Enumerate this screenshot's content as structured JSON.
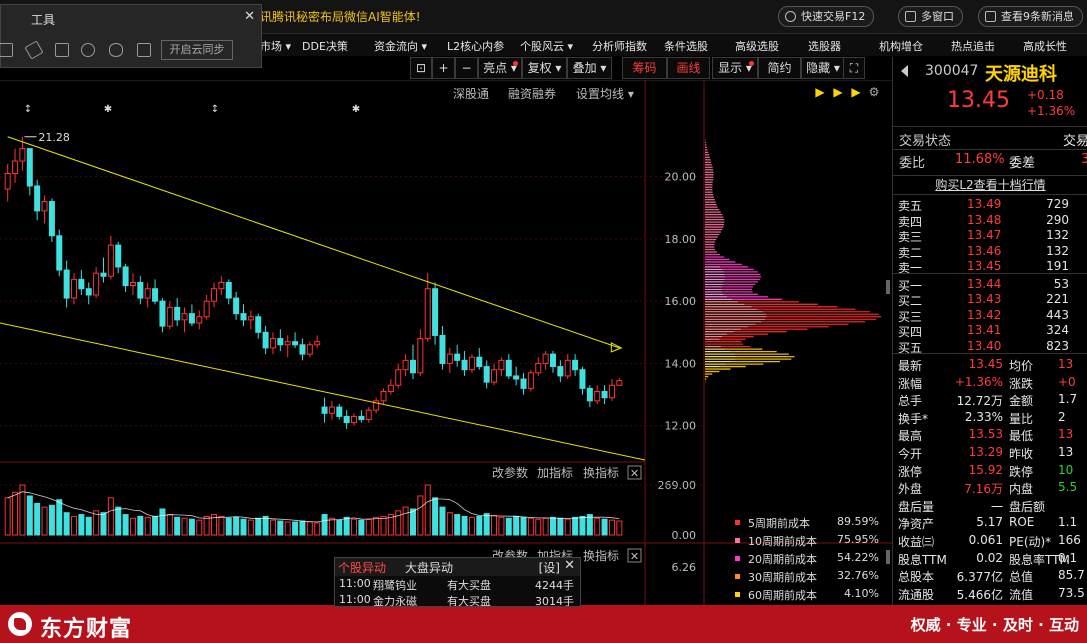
{
  "topbar": {
    "news": "讯腾讯秘密布局微信AI智能体!",
    "quick_trade": "快速交易F12",
    "multi_window": "多窗口",
    "messages": "查看9条新消息"
  },
  "tool_panel": {
    "title": "工具",
    "sync": "开启云同步",
    "icons": [
      "brush-icon",
      "eraser-icon",
      "trash-icon",
      "gear-icon",
      "eye-icon",
      "export-icon"
    ]
  },
  "menu": [
    "市场 ▾",
    "DDE决策",
    "资金流向 ▾",
    "L2核心内参",
    "个股风云 ▾",
    "分析师指数",
    "条件选股",
    "高级选股",
    "选股器",
    "机构增仓",
    "热点追击",
    "高成长性"
  ],
  "chart_toolbar": {
    "buttons": [
      "⊡",
      "+",
      "−",
      "亮点 ▾",
      "复权 ▾",
      "叠加 ▾",
      "筹码",
      "画线",
      "显示 ▾",
      "简约",
      "隐藏 ▾",
      "⛶"
    ]
  },
  "sub_links": [
    "深股通",
    "融资融券",
    "设置均线 ▾"
  ],
  "chart_data": {
    "type": "candlestick",
    "y_axis_ticks": [
      "20.00",
      "18.00",
      "16.00",
      "14.00",
      "12.00"
    ],
    "ylim": [
      10.9,
      22.3
    ],
    "annotation_high": "21.28",
    "volume_axis_ticks": [
      "269.00",
      "0.00"
    ],
    "indicator_value": "6.26",
    "volume_labels": [
      "改参数",
      "加指标",
      "换指标"
    ],
    "candles": [
      [
        19.6,
        20.4,
        19.2,
        20.1
      ],
      [
        20.1,
        20.9,
        19.8,
        20.5
      ],
      [
        20.5,
        21.28,
        20.2,
        20.9
      ],
      [
        20.9,
        20.9,
        19.4,
        19.7
      ],
      [
        19.7,
        19.9,
        18.6,
        18.9
      ],
      [
        18.9,
        19.4,
        18.5,
        19.2
      ],
      [
        19.2,
        19.3,
        17.9,
        18.1
      ],
      [
        18.1,
        18.3,
        16.8,
        17.0
      ],
      [
        17.0,
        17.3,
        15.8,
        16.1
      ],
      [
        16.1,
        16.9,
        15.9,
        16.7
      ],
      [
        16.7,
        17.0,
        16.2,
        16.4
      ],
      [
        16.4,
        16.6,
        15.9,
        16.2
      ],
      [
        16.2,
        17.1,
        16.1,
        16.9
      ],
      [
        16.9,
        17.4,
        16.6,
        16.8
      ],
      [
        16.8,
        18.1,
        16.7,
        17.8
      ],
      [
        17.8,
        17.9,
        16.9,
        17.1
      ],
      [
        17.1,
        17.2,
        16.3,
        16.5
      ],
      [
        16.5,
        16.9,
        16.2,
        16.6
      ],
      [
        16.6,
        16.8,
        15.9,
        16.1
      ],
      [
        16.1,
        16.6,
        15.8,
        16.4
      ],
      [
        16.4,
        16.7,
        15.9,
        16.0
      ],
      [
        16.0,
        16.1,
        15.0,
        15.2
      ],
      [
        15.2,
        16.0,
        15.1,
        15.8
      ],
      [
        15.8,
        16.1,
        15.2,
        15.4
      ],
      [
        15.4,
        15.8,
        15.0,
        15.6
      ],
      [
        15.6,
        15.9,
        15.2,
        15.3
      ],
      [
        15.3,
        15.7,
        15.1,
        15.5
      ],
      [
        15.5,
        16.2,
        15.4,
        16.0
      ],
      [
        16.0,
        16.6,
        15.8,
        16.4
      ],
      [
        16.4,
        16.8,
        16.2,
        16.6
      ],
      [
        16.6,
        16.7,
        15.9,
        16.1
      ],
      [
        16.1,
        16.3,
        15.4,
        15.6
      ],
      [
        15.6,
        15.9,
        15.2,
        15.4
      ],
      [
        15.4,
        15.7,
        15.1,
        15.5
      ],
      [
        15.5,
        15.6,
        14.8,
        15.0
      ],
      [
        15.0,
        15.2,
        14.3,
        14.5
      ],
      [
        14.5,
        15.0,
        14.3,
        14.8
      ],
      [
        14.8,
        15.1,
        14.4,
        14.6
      ],
      [
        14.6,
        14.9,
        14.2,
        14.7
      ],
      [
        14.7,
        15.0,
        14.5,
        14.6
      ],
      [
        14.6,
        14.8,
        14.1,
        14.3
      ],
      [
        14.3,
        14.7,
        14.2,
        14.6
      ],
      [
        14.6,
        14.9,
        14.5,
        14.7
      ],
      [
        12.6,
        12.9,
        12.1,
        12.4
      ],
      [
        12.4,
        12.8,
        12.2,
        12.6
      ],
      [
        12.6,
        12.7,
        12.2,
        12.3
      ],
      [
        12.3,
        12.5,
        11.9,
        12.1
      ],
      [
        12.1,
        12.4,
        12.0,
        12.3
      ],
      [
        12.3,
        12.5,
        12.1,
        12.2
      ],
      [
        12.2,
        12.6,
        12.1,
        12.5
      ],
      [
        12.5,
        12.9,
        12.4,
        12.8
      ],
      [
        12.8,
        13.2,
        12.7,
        13.1
      ],
      [
        13.1,
        13.5,
        13.0,
        13.3
      ],
      [
        13.3,
        14.0,
        13.2,
        13.8
      ],
      [
        13.8,
        14.3,
        13.6,
        14.1
      ],
      [
        14.1,
        14.6,
        13.5,
        13.7
      ],
      [
        13.7,
        15.1,
        13.6,
        14.8
      ],
      [
        14.8,
        16.9,
        14.7,
        16.4
      ],
      [
        16.4,
        16.6,
        14.6,
        14.9
      ],
      [
        14.9,
        15.2,
        13.8,
        14.0
      ],
      [
        14.0,
        14.5,
        13.7,
        14.3
      ],
      [
        14.3,
        14.6,
        13.9,
        14.1
      ],
      [
        14.1,
        14.4,
        13.6,
        13.8
      ],
      [
        13.8,
        14.3,
        13.7,
        14.2
      ],
      [
        14.2,
        14.5,
        13.8,
        13.9
      ],
      [
        13.9,
        14.1,
        13.2,
        13.4
      ],
      [
        13.4,
        14.0,
        13.3,
        13.8
      ],
      [
        13.8,
        14.2,
        13.6,
        14.1
      ],
      [
        14.1,
        14.3,
        13.5,
        13.6
      ],
      [
        13.6,
        13.9,
        13.3,
        13.5
      ],
      [
        13.5,
        13.7,
        13.0,
        13.2
      ],
      [
        13.2,
        13.8,
        13.1,
        13.7
      ],
      [
        13.7,
        14.2,
        13.6,
        14.0
      ],
      [
        14.0,
        14.4,
        13.8,
        14.3
      ],
      [
        14.3,
        14.4,
        13.7,
        13.9
      ],
      [
        13.9,
        14.1,
        13.4,
        13.6
      ],
      [
        13.6,
        14.3,
        13.5,
        14.1
      ],
      [
        14.1,
        14.3,
        13.6,
        13.8
      ],
      [
        13.8,
        13.9,
        13.0,
        13.2
      ],
      [
        13.2,
        13.3,
        12.6,
        12.8
      ],
      [
        12.8,
        13.3,
        12.7,
        13.1
      ],
      [
        13.1,
        13.3,
        12.7,
        12.9
      ],
      [
        12.9,
        13.5,
        12.8,
        13.3
      ],
      [
        13.3,
        13.53,
        13.29,
        13.45
      ]
    ],
    "volumes": [
      200,
      230,
      269,
      210,
      170,
      150,
      160,
      190,
      120,
      100,
      110,
      95,
      130,
      120,
      200,
      150,
      110,
      90,
      100,
      95,
      100,
      140,
      110,
      95,
      90,
      85,
      80,
      100,
      110,
      100,
      90,
      95,
      85,
      80,
      90,
      100,
      80,
      75,
      70,
      70,
      75,
      70,
      65,
      110,
      90,
      80,
      95,
      85,
      80,
      85,
      95,
      100,
      110,
      130,
      150,
      140,
      210,
      269,
      200,
      150,
      120,
      110,
      100,
      95,
      100,
      115,
      105,
      95,
      90,
      100,
      95,
      90,
      85,
      90,
      95,
      90,
      85,
      95,
      100,
      110,
      90,
      85,
      80,
      75
    ],
    "channel_upper": [
      [
        21.28,
        0
      ],
      [
        14.5,
        83
      ]
    ],
    "channel_lower": [
      [
        15.3,
        -3
      ],
      [
        10.9,
        88
      ]
    ],
    "chip_legend": [
      {
        "name": "5周期前成本",
        "pct": "89.59%",
        "color": "#ff2d2d"
      },
      {
        "name": "10周期前成本",
        "pct": "75.95%",
        "color": "#ff6fa0"
      },
      {
        "name": "20周期前成本",
        "pct": "54.22%",
        "color": "#ff3cc8"
      },
      {
        "name": "30周期前成本",
        "pct": "32.76%",
        "color": "#ff8c1a"
      },
      {
        "name": "60周期前成本",
        "pct": "4.10%",
        "color": "#ffd400"
      }
    ]
  },
  "alert_popup": {
    "tab_active": "个股异动",
    "tab_other": "大盘异动",
    "settings": "[设]",
    "rows": [
      {
        "time": "11:00",
        "name": "翔鹭钨业",
        "event": "有大买盘",
        "qty": "4244手"
      },
      {
        "time": "11:00",
        "name": "金力永磁",
        "event": "有大买盘",
        "qty": "3014手"
      }
    ]
  },
  "footer": {
    "brand": "东方财富",
    "slogan": "权威 · 专业 · 及时 · 互动"
  },
  "quote": {
    "code": "300047",
    "name": "天源迪科",
    "price": "13.45",
    "change": "+0.18",
    "change_pct": "+1.36%",
    "status_label": "交易状态",
    "status_label2": "交易",
    "wb_label": "委比",
    "wb_value": "11.68%",
    "wc_label": "委差",
    "wc_value": "3",
    "l2_banner": "购买L2查看十档行情",
    "asks": [
      {
        "label": "卖五",
        "price": "13.49",
        "vol": "729"
      },
      {
        "label": "卖四",
        "price": "13.48",
        "vol": "290"
      },
      {
        "label": "卖三",
        "price": "13.47",
        "vol": "132"
      },
      {
        "label": "卖二",
        "price": "13.46",
        "vol": "132"
      },
      {
        "label": "卖一",
        "price": "13.45",
        "vol": "191"
      }
    ],
    "bids": [
      {
        "label": "买一",
        "price": "13.44",
        "vol": "53"
      },
      {
        "label": "买二",
        "price": "13.43",
        "vol": "221"
      },
      {
        "label": "买三",
        "price": "13.42",
        "vol": "443"
      },
      {
        "label": "买四",
        "price": "13.41",
        "vol": "324"
      },
      {
        "label": "买五",
        "price": "13.40",
        "vol": "823"
      }
    ],
    "stats": [
      {
        "l1": "最新",
        "v1": "13.45",
        "c1": "red",
        "l2": "均价",
        "v2": "13",
        "c2": "red"
      },
      {
        "l1": "涨幅",
        "v1": "+1.36%",
        "c1": "red",
        "l2": "涨跌",
        "v2": "+0",
        "c2": "red"
      },
      {
        "l1": "总手",
        "v1": "12.72万",
        "c1": "white",
        "l2": "金额",
        "v2": "1.7",
        "c2": "white"
      },
      {
        "l1": "换手*",
        "v1": "2.33%",
        "c1": "white",
        "l2": "量比",
        "v2": "2",
        "c2": "white"
      },
      {
        "l1": "最高",
        "v1": "13.53",
        "c1": "red",
        "l2": "最低",
        "v2": "13",
        "c2": "red"
      },
      {
        "l1": "今开",
        "v1": "13.29",
        "c1": "red",
        "l2": "昨收",
        "v2": "13",
        "c2": "white"
      },
      {
        "l1": "涨停",
        "v1": "15.92",
        "c1": "red",
        "l2": "跌停",
        "v2": "10",
        "c2": "green"
      },
      {
        "l1": "外盘",
        "v1": "7.16万",
        "c1": "red",
        "l2": "内盘",
        "v2": "5.5",
        "c2": "green"
      },
      {
        "l1": "盘后量",
        "v1": "一",
        "c1": "white",
        "l2": "盘后额",
        "v2": "",
        "c2": "white"
      },
      {
        "l1": "净资产",
        "v1": "5.17",
        "c1": "white",
        "l2": "ROE",
        "v2": "1.1",
        "c2": "white"
      },
      {
        "l1": "收益㈢",
        "v1": "0.061",
        "c1": "white",
        "l2": "PE(动)*",
        "v2": "166",
        "c2": "white"
      },
      {
        "l1": "股息TTM",
        "v1": "0.02",
        "c1": "white",
        "l2": "股息率TTM",
        "v2": "0.1",
        "c2": "white"
      },
      {
        "l1": "总股本",
        "v1": "6.377亿",
        "c1": "white",
        "l2": "总值",
        "v2": "85.7",
        "c2": "white"
      },
      {
        "l1": "流通股",
        "v1": "5.466亿",
        "c1": "white",
        "l2": "流值",
        "v2": "73.5",
        "c2": "white"
      }
    ]
  }
}
